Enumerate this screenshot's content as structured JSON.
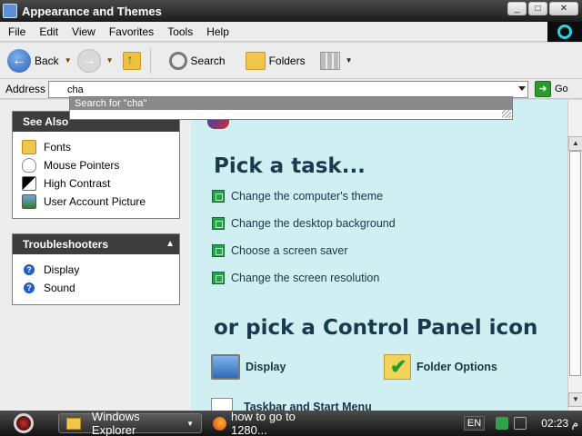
{
  "window": {
    "title": "Appearance and Themes",
    "controls": {
      "minimize": "_",
      "maximize": "□",
      "close": "✕"
    }
  },
  "menu": [
    "File",
    "Edit",
    "View",
    "Favorites",
    "Tools",
    "Help"
  ],
  "toolbar": {
    "back_label": "Back",
    "search_label": "Search",
    "folders_label": "Folders"
  },
  "address": {
    "label": "Address",
    "value": "cha",
    "go_label": "Go",
    "suggestion": "Search for \"cha\""
  },
  "see_also": {
    "title": "See Also",
    "items": [
      "Fonts",
      "Mouse Pointers",
      "High Contrast",
      "User Account Picture"
    ]
  },
  "troubleshooters": {
    "title": "Troubleshooters",
    "items": [
      "Display",
      "Sound"
    ]
  },
  "main": {
    "pick_task_heading": "Pick a task...",
    "tasks": [
      "Change the computer's theme",
      "Change the desktop background",
      "Choose a screen saver",
      "Change the screen resolution"
    ],
    "pick_icon_heading": "or pick a Control Panel icon",
    "icons": [
      {
        "label": "Display",
        "icon": "display-icon"
      },
      {
        "label": "Folder Options",
        "icon": "folder-options-icon"
      },
      {
        "label": "Taskbar and Start Menu",
        "icon": "taskbar-icon"
      }
    ]
  },
  "taskbar": {
    "buttons": [
      "Windows Explorer",
      "how to go to 1280..."
    ],
    "language": "EN",
    "clock": "02:23 م"
  },
  "colors": {
    "content_bg": "#cfeff3",
    "heading": "#183a4d",
    "pane_header": "#3d3d3d",
    "title_bar": "#1c1c1c",
    "task_bullet": "#27a14a"
  }
}
